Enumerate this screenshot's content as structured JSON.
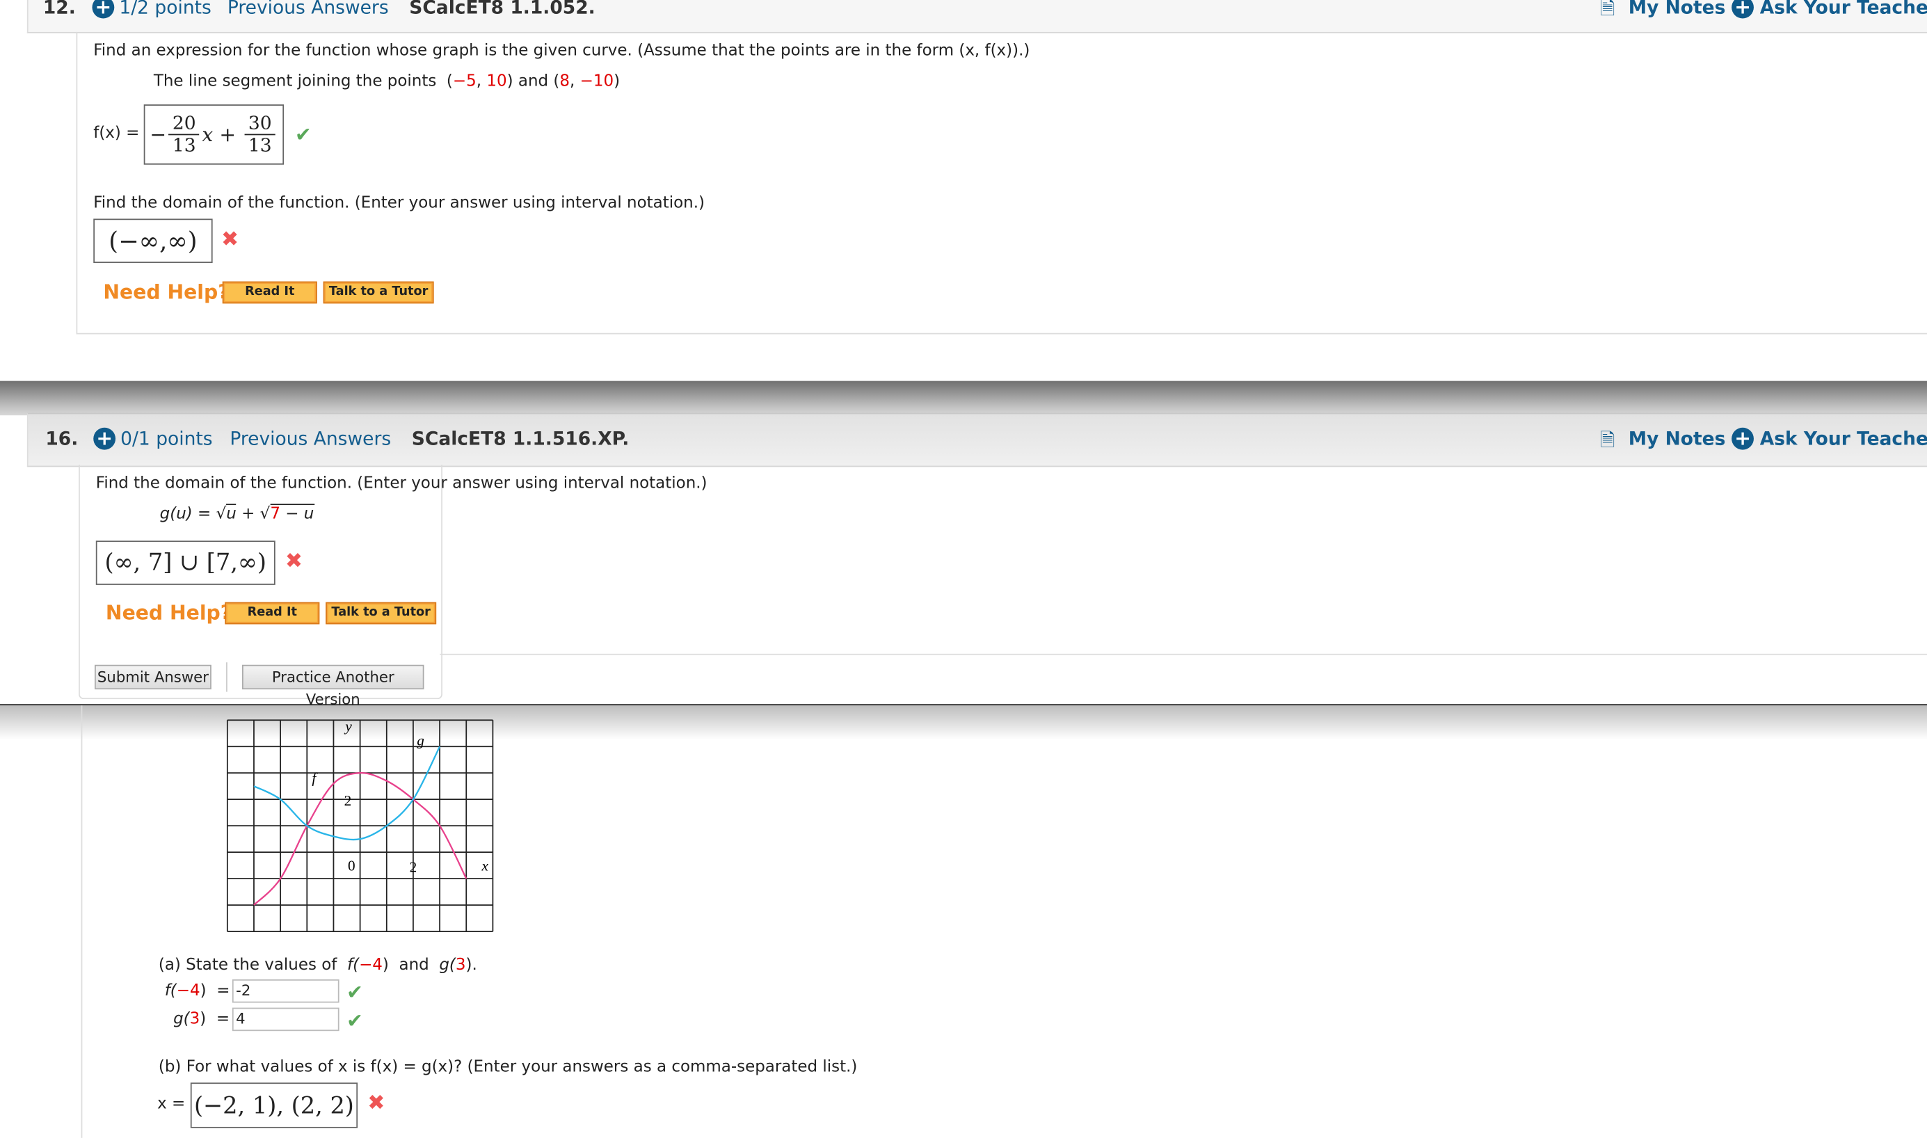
{
  "q12": {
    "number": "12.",
    "points": "1/2 points",
    "previous_answers": "Previous Answers",
    "code": "SCalcET8 1.1.052.",
    "my_notes": "My Notes",
    "ask_teacher": "Ask Your Teacher",
    "prompt": "Find an expression for the function whose graph is the given curve. (Assume that the points are in the form (x, f(x)).)",
    "segment_text": "The line segment joining the points",
    "p1x": "−5",
    "p1y": "10",
    "and": "and",
    "p2x": "8",
    "p2y": "−10",
    "fx_label": "f(x) =",
    "answer1": {
      "sign": "−",
      "num1": "20",
      "den1": "13",
      "var": "x",
      "plus": "+",
      "num2": "30",
      "den2": "13",
      "status": "correct"
    },
    "domain_prompt": "Find the domain of the function. (Enter your answer using interval notation.)",
    "answer2": {
      "value": "(−∞,∞)",
      "status": "incorrect"
    },
    "need_help": "Need Help?",
    "read_it": "Read It",
    "talk_tutor": "Talk to a Tutor"
  },
  "q16": {
    "number": "16.",
    "points": "0/1 points",
    "previous_answers": "Previous Answers",
    "code": "SCalcET8 1.1.516.XP.",
    "my_notes": "My Notes",
    "ask_teacher": "Ask Your Teacher",
    "prompt": "Find the domain of the function. (Enter your answer using interval notation.)",
    "g_label": "g(u) = ",
    "sqrt1": "u",
    "plus": " + ",
    "sqrt2_num": "7",
    "sqrt2_rest": " − u",
    "answer": {
      "value": "(∞, 7] ∪ [7,∞)",
      "status": "incorrect"
    },
    "need_help": "Need Help?",
    "read_it": "Read It",
    "talk_tutor": "Talk to a Tutor",
    "submit": "Submit Answer",
    "practice": "Practice Another Version"
  },
  "q_next": {
    "graph": {
      "x_label": "x",
      "y_label": "y",
      "origin_label": "0",
      "x_tick": "2",
      "y_tick": "2",
      "f_label": "f",
      "g_label": "g",
      "x_range": [
        -5,
        5
      ],
      "y_range": [
        -3,
        5
      ],
      "f_color": "#e8418c",
      "g_color": "#29b5e8",
      "f_points": [
        [
          -4,
          -2
        ],
        [
          -3,
          -1
        ],
        [
          -2,
          1
        ],
        [
          -1,
          2.6
        ],
        [
          0,
          3
        ],
        [
          1,
          2.7
        ],
        [
          2,
          2
        ],
        [
          3,
          1
        ],
        [
          4,
          -1
        ]
      ],
      "g_points": [
        [
          -4,
          2.5
        ],
        [
          -3,
          2
        ],
        [
          -2,
          1
        ],
        [
          -1,
          0.6
        ],
        [
          0,
          0.5
        ],
        [
          1,
          1
        ],
        [
          2,
          2
        ],
        [
          3,
          4
        ]
      ]
    },
    "part_a": "(a) State the values of",
    "a_f": "f(",
    "a_f_arg": "−4",
    "a_close": ")",
    "a_and": "and",
    "a_g": "g(",
    "a_g_arg": "3",
    "a_end": ").",
    "f_row_label": "f(",
    "f_row_arg": "−4",
    "f_row_end": ")  =",
    "f_value": "-2",
    "g_row_label": "g(",
    "g_row_arg": "3",
    "g_row_end": ")  =",
    "g_value": "4",
    "part_b": "(b) For what values of x is f(x) = g(x)? (Enter your answers as a comma-separated list.)",
    "x_label": "x =",
    "b_answer": {
      "value": "(−2, 1), (2, 2)",
      "status": "incorrect"
    }
  },
  "colors": {
    "link": "#145d8e",
    "accent_orange": "#f08a24",
    "correct": "#5aa85a",
    "incorrect": "#ee5555",
    "highlight_red": "#e00000"
  }
}
